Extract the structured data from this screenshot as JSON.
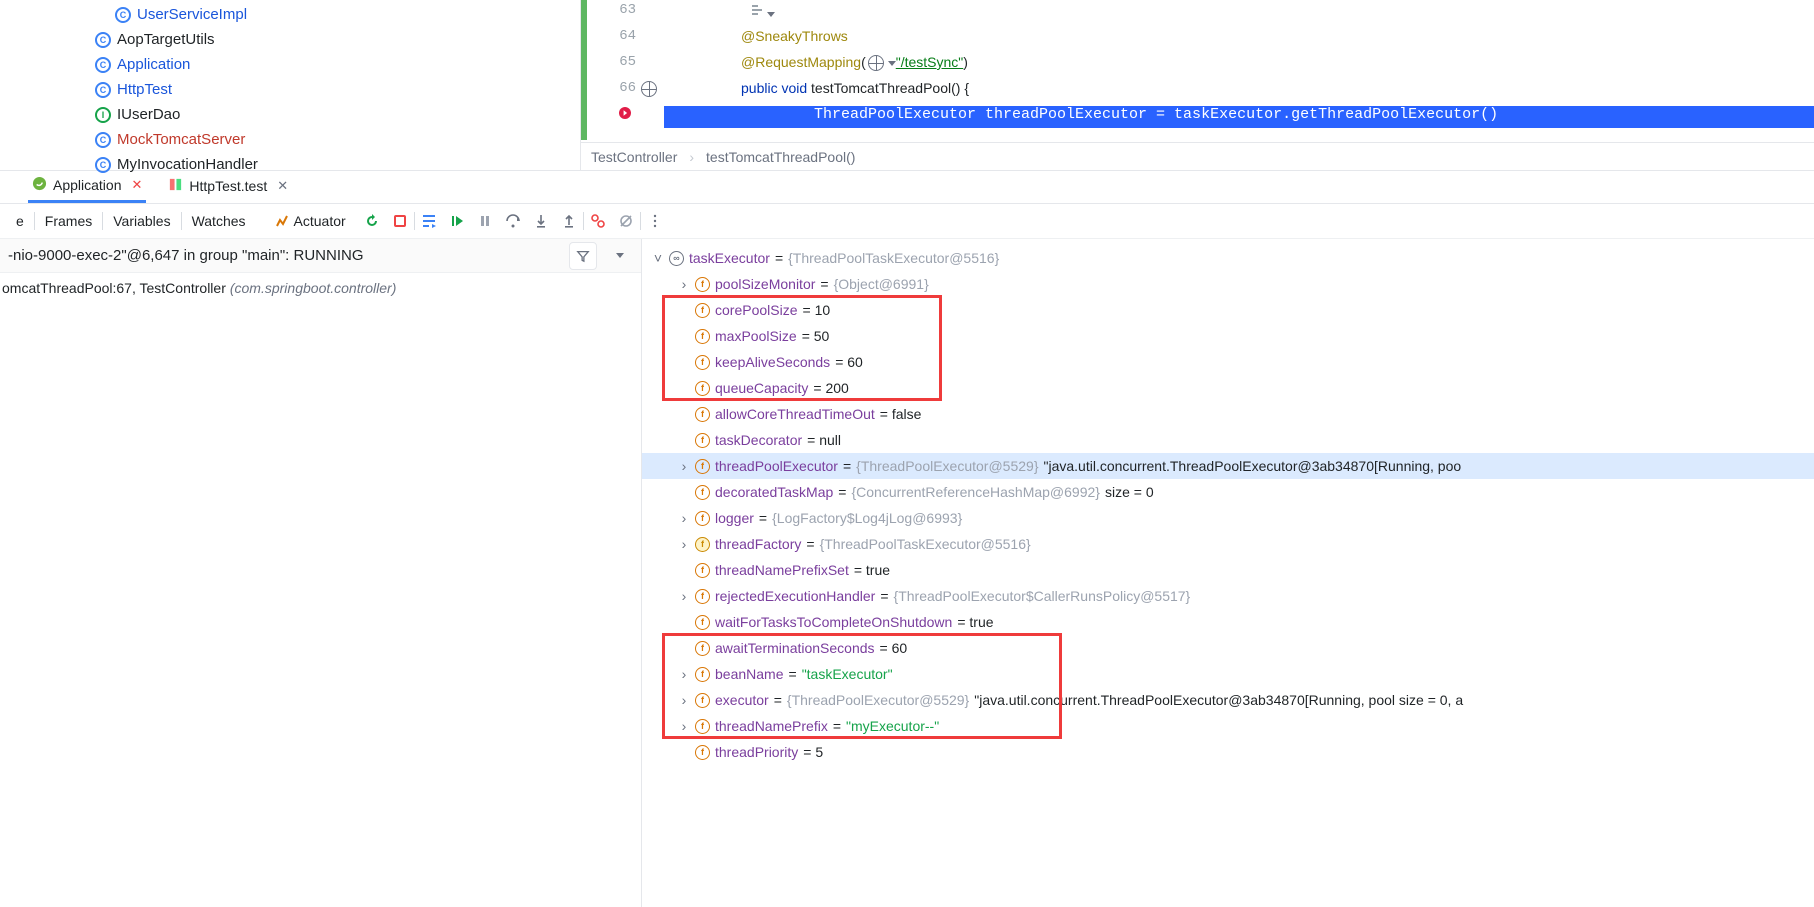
{
  "projectTree": {
    "items": [
      {
        "icon": "c",
        "label": "UserServiceImpl",
        "cls": "blue",
        "indent": 1
      },
      {
        "icon": "c",
        "label": "AopTargetUtils",
        "cls": "",
        "indent": 0
      },
      {
        "icon": "c",
        "label": "Application",
        "cls": "blue",
        "indent": 0
      },
      {
        "icon": "c",
        "label": "HttpTest",
        "cls": "blue",
        "indent": 0
      },
      {
        "icon": "i",
        "label": "IUserDao",
        "cls": "",
        "indent": 0
      },
      {
        "icon": "c",
        "label": "MockTomcatServer",
        "cls": "red",
        "indent": 0
      },
      {
        "icon": "c",
        "label": "MyInvocationHandler",
        "cls": "",
        "indent": 0
      }
    ]
  },
  "editor": {
    "lines": {
      "l63": "63",
      "l64": "64",
      "l65": "65",
      "l66": "66"
    },
    "ann_sneaky": "@SneakyThrows",
    "ann_rm": "@RequestMapping",
    "rm_path": "\"/testSync\"",
    "sig_pre": "public void ",
    "sig_name": "testTomcatThreadPool",
    "sig_post": "() {",
    "hl": "ThreadPoolExecutor threadPoolExecutor = taskExecutor.getThreadPoolExecutor()"
  },
  "breadcrumb": {
    "a": "TestController",
    "b": "testTomcatThreadPool()"
  },
  "tabs": {
    "app": "Application",
    "http": "HttpTest.test"
  },
  "toolbar": {
    "e": "e",
    "frames": "Frames",
    "vars": "Variables",
    "watches": "Watches",
    "act": "Actuator"
  },
  "frames": {
    "thread": "-nio-9000-exec-2\"@6,647 in group \"main\": RUNNING",
    "row_pre": "omcatThreadPool:67, TestController ",
    "row_loc": "(com.springboot.controller)"
  },
  "vars": [
    {
      "d": 0,
      "a": "v",
      "i": "ob",
      "n": "taskExecutor",
      "e": " = ",
      "g": "{ThreadPoolTaskExecutor@5516}",
      "sel": false
    },
    {
      "d": 1,
      "a": ">",
      "i": "f",
      "n": "poolSizeMonitor",
      "e": " = ",
      "g": "{Object@6991}",
      "sel": false
    },
    {
      "d": 1,
      "a": "",
      "i": "f",
      "n": "corePoolSize",
      "e": " = 10",
      "sel": false,
      "box": "b1"
    },
    {
      "d": 1,
      "a": "",
      "i": "f",
      "n": "maxPoolSize",
      "e": " = 50",
      "sel": false,
      "box": "b1"
    },
    {
      "d": 1,
      "a": "",
      "i": "f",
      "n": "keepAliveSeconds",
      "e": " = 60",
      "sel": false,
      "box": "b1"
    },
    {
      "d": 1,
      "a": "",
      "i": "f",
      "n": "queueCapacity",
      "e": " = 200",
      "sel": false,
      "box": "b1"
    },
    {
      "d": 1,
      "a": "",
      "i": "f",
      "n": "allowCoreThreadTimeOut",
      "e": " = false",
      "sel": false
    },
    {
      "d": 1,
      "a": "",
      "i": "f",
      "n": "taskDecorator",
      "e": " = null",
      "sel": false
    },
    {
      "d": 1,
      "a": ">",
      "i": "f",
      "n": "threadPoolExecutor",
      "e": " = ",
      "g": "{ThreadPoolExecutor@5529} ",
      "t": "\"java.util.concurrent.ThreadPoolExecutor@3ab34870[Running, poo",
      "sel": true
    },
    {
      "d": 1,
      "a": "",
      "i": "f",
      "n": "decoratedTaskMap",
      "e": " = ",
      "g": "{ConcurrentReferenceHashMap@6992} ",
      " t": " size = 0",
      "sel": false
    },
    {
      "d": 1,
      "a": ">",
      "i": "f",
      "n": "logger",
      "e": " = ",
      "g": "{LogFactory$Log4jLog@6993}",
      "sel": false
    },
    {
      "d": 1,
      "a": ">",
      "i": "y",
      "n": "threadFactory",
      "e": " = ",
      "g": "{ThreadPoolTaskExecutor@5516}",
      "sel": false
    },
    {
      "d": 1,
      "a": "",
      "i": "f",
      "n": "threadNamePrefixSet",
      "e": " = true",
      "sel": false
    },
    {
      "d": 1,
      "a": ">",
      "i": "f",
      "n": "rejectedExecutionHandler",
      "e": " = ",
      "g": "{ThreadPoolExecutor$CallerRunsPolicy@5517}",
      "sel": false
    },
    {
      "d": 1,
      "a": "",
      "i": "f",
      "n": "waitForTasksToCompleteOnShutdown",
      "e": " = true",
      "sel": false
    },
    {
      "d": 1,
      "a": "",
      "i": "f",
      "n": "awaitTerminationSeconds",
      "e": " = 60",
      "sel": false,
      "box": "b2"
    },
    {
      "d": 1,
      "a": ">",
      "i": "f",
      "n": "beanName",
      "e": " = ",
      "s": "\"taskExecutor\"",
      "sel": false,
      "box": "b2"
    },
    {
      "d": 1,
      "a": ">",
      "i": "f",
      "n": "executor",
      "e": " = ",
      "g": "{ThreadPoolExecutor@5529} ",
      "t": "\"java.util.concurrent.ThreadPoolExecutor@3ab34870[Running, pool size = 0, a",
      "sel": false,
      "box": "b2"
    },
    {
      "d": 1,
      "a": ">",
      "i": "f",
      "n": "threadNamePrefix",
      "e": " = ",
      "s": "\"myExecutor--\"",
      "sel": false,
      "box": "b2"
    },
    {
      "d": 1,
      "a": "",
      "i": "f",
      "n": "threadPriority",
      "e": " = 5",
      "sel": false
    }
  ]
}
